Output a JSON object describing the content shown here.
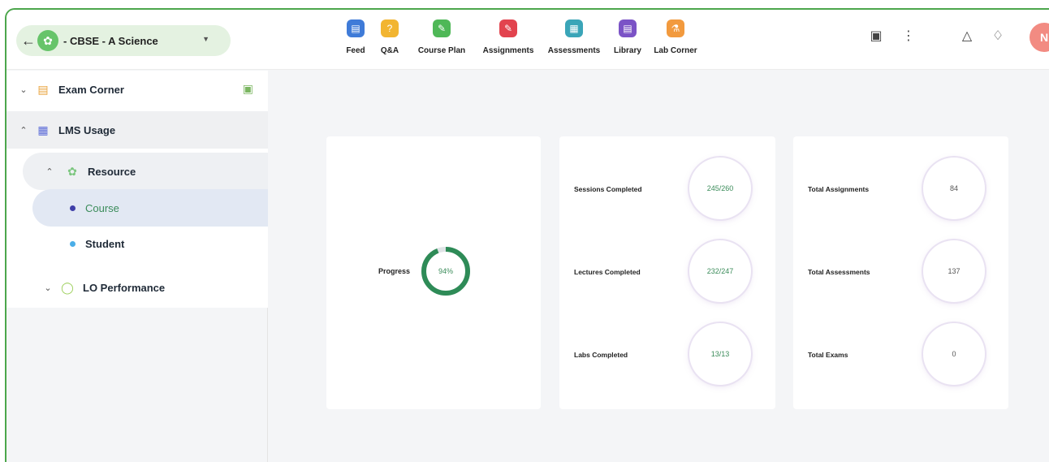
{
  "header": {
    "class_label": "- CBSE - A Science",
    "tabs": [
      {
        "label": "Feed",
        "icon": "feed-icon",
        "color": "#3f7bd8"
      },
      {
        "label": "Q&A",
        "icon": "qa-icon",
        "color": "#f2b531"
      },
      {
        "label": "Course Plan",
        "icon": "course-plan-icon",
        "color": "#4fb857"
      },
      {
        "label": "Assignments",
        "icon": "assignments-icon",
        "color": "#e2434e"
      },
      {
        "label": "Assessments",
        "icon": "assessments-icon",
        "color": "#3aa5b8"
      },
      {
        "label": "Library",
        "icon": "library-icon",
        "color": "#7b53c6"
      },
      {
        "label": "Lab Corner",
        "icon": "lab-corner-icon",
        "color": "#f29a3e"
      }
    ],
    "avatar_initial": "N"
  },
  "sidebar": {
    "exam_corner": "Exam Corner",
    "lms_usage": "LMS Usage",
    "resource": "Resource",
    "course": "Course",
    "student": "Student",
    "lo_performance": "LO Performance"
  },
  "progress_card": {
    "label": "Progress",
    "value_text": "94%",
    "percent": 94,
    "color": "#2e8b57"
  },
  "sessions_card": {
    "items": [
      {
        "label": "Sessions Completed",
        "value": "245/260"
      },
      {
        "label": "Lectures Completed",
        "value": "232/247"
      },
      {
        "label": "Labs Completed",
        "value": "13/13"
      }
    ]
  },
  "totals_card": {
    "items": [
      {
        "label": "Total Assignments",
        "value": "84"
      },
      {
        "label": "Total Assessments",
        "value": "137"
      },
      {
        "label": "Total Exams",
        "value": "0"
      }
    ]
  }
}
